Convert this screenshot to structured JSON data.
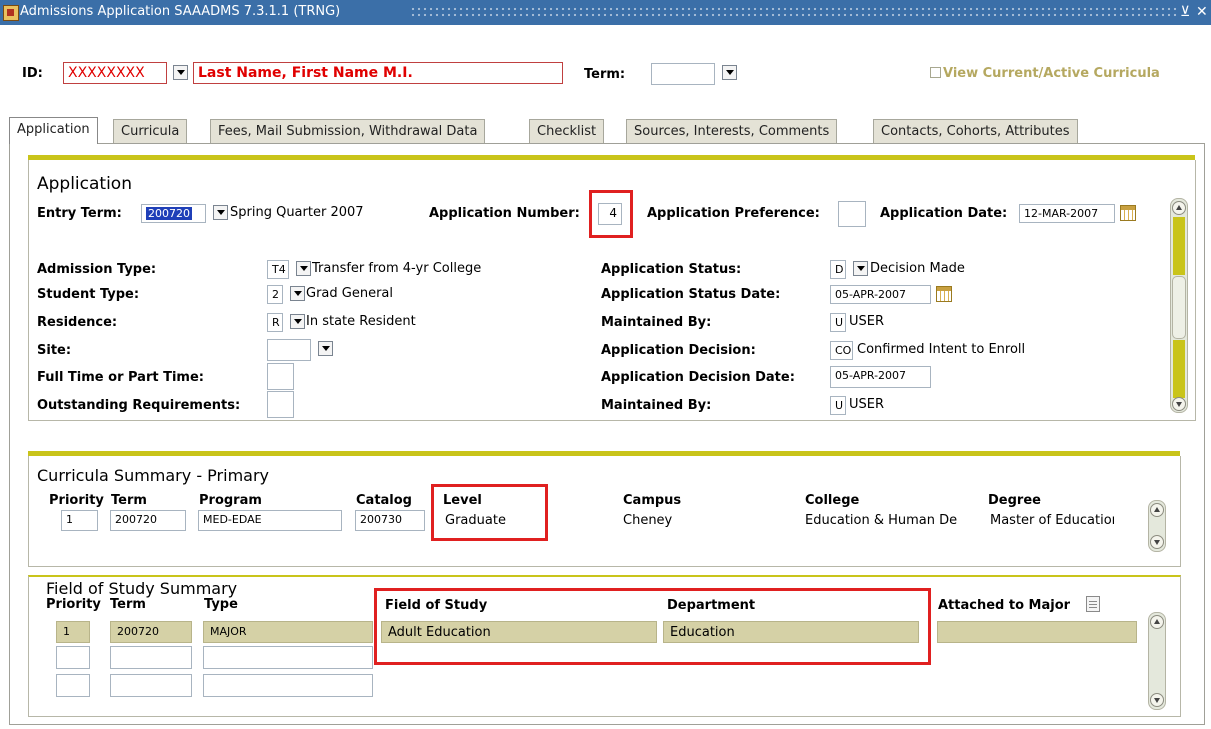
{
  "window": {
    "title": "Admissions Application  SAAADMS  7.3.1.1  (TRNG)",
    "minimize": "⊻",
    "close": "✕"
  },
  "key_block": {
    "id_label": "ID:",
    "id_value": "XXXXXXXX",
    "name_value": "Last Name, First Name M.I.",
    "term_label": "Term:",
    "term_value": "",
    "view_curricula_label": "View Current/Active Curricula"
  },
  "tabs": [
    {
      "label": "Application",
      "active": true
    },
    {
      "label": "Curricula"
    },
    {
      "label": "Fees, Mail Submission, Withdrawal Data"
    },
    {
      "label": "Checklist"
    },
    {
      "label": "Sources, Interests, Comments"
    },
    {
      "label": "Contacts, Cohorts, Attributes"
    }
  ],
  "application": {
    "section_title": "Application",
    "entry_term_label": "Entry Term:",
    "entry_term_value": "200720",
    "entry_term_desc": "Spring Quarter 2007",
    "app_number_label": "Application Number:",
    "app_number_value": "4",
    "app_pref_label": "Application Preference:",
    "app_pref_value": "",
    "app_date_label": "Application Date:",
    "app_date_value": "12-MAR-2007",
    "admission_type_label": "Admission Type:",
    "admission_type_code": "T4",
    "admission_type_desc": "Transfer from 4-yr College",
    "student_type_label": "Student Type:",
    "student_type_code": "2",
    "student_type_desc": "Grad General",
    "residence_label": "Residence:",
    "residence_code": "R",
    "residence_desc": "In state Resident",
    "site_label": "Site:",
    "site_code": "",
    "full_part_label": "Full Time or Part Time:",
    "full_part_value": "",
    "outstanding_label": "Outstanding Requirements:",
    "outstanding_value": "",
    "status_label": "Application Status:",
    "status_code": "D",
    "status_desc": "Decision Made",
    "status_date_label": "Application Status Date:",
    "status_date_value": "05-APR-2007",
    "maintained_by_label": "Maintained By:",
    "maintained_by_code": "U",
    "maintained_by_desc": "USER",
    "decision_label": "Application Decision:",
    "decision_code": "CO",
    "decision_desc": "Confirmed Intent to Enroll",
    "decision_date_label": "Application Decision Date:",
    "decision_date_value": "05-APR-2007",
    "maintained_by2_label": "Maintained By:",
    "maintained_by2_code": "U",
    "maintained_by2_desc": "USER"
  },
  "curricula_summary": {
    "title": "Curricula Summary - Primary",
    "headers": {
      "priority": "Priority",
      "term": "Term",
      "program": "Program",
      "catalog": "Catalog",
      "level": "Level",
      "campus": "Campus",
      "college": "College",
      "degree": "Degree"
    },
    "row": {
      "priority": "1",
      "term": "200720",
      "program": "MED-EDAE",
      "catalog": "200730",
      "level": "Graduate",
      "campus": "Cheney",
      "college": "Education & Human De",
      "degree": "Master of Educatioı"
    }
  },
  "field_of_study": {
    "title": "Field of Study Summary",
    "headers": {
      "priority": "Priority",
      "term": "Term",
      "type": "Type",
      "field": "Field of Study",
      "department": "Department",
      "attached": "Attached to Major"
    },
    "row": {
      "priority": "1",
      "term": "200720",
      "type": "MAJOR",
      "field": "Adult Education",
      "department": "Education"
    }
  },
  "colors": {
    "title_bar": "#3b6fa8",
    "accent_olive": "#c9c41a",
    "highlight_red": "#e02020",
    "id_red": "#e00000"
  }
}
